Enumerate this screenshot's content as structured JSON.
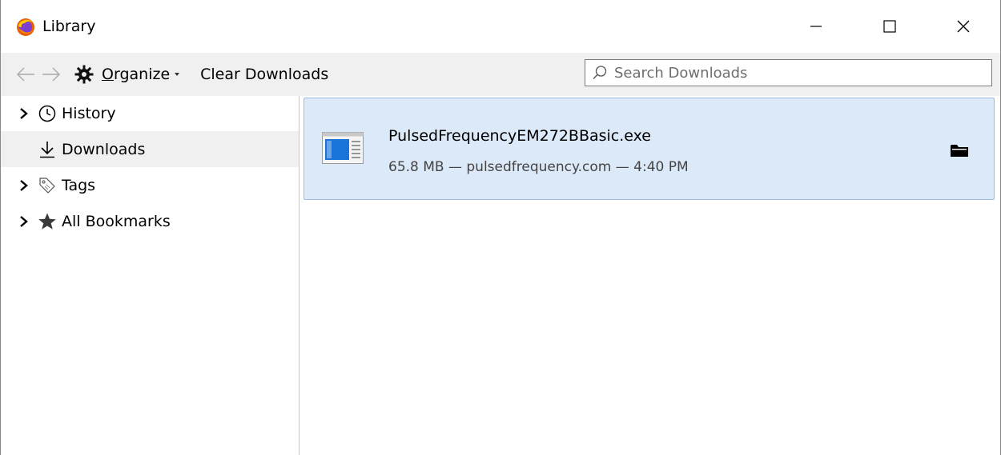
{
  "window": {
    "title": "Library",
    "controls": [
      "minimize",
      "maximize",
      "close"
    ]
  },
  "toolbar": {
    "organize_label_underlined": "O",
    "organize_label_rest": "rganize",
    "clear_downloads_label": "Clear Downloads",
    "search_placeholder": "Search Downloads",
    "search_value": ""
  },
  "sidebar": {
    "items": [
      {
        "label": "History",
        "icon": "clock-icon",
        "expandable": true,
        "selected": false
      },
      {
        "label": "Downloads",
        "icon": "download-icon",
        "expandable": false,
        "selected": true
      },
      {
        "label": "Tags",
        "icon": "tag-icon",
        "expandable": true,
        "selected": false
      },
      {
        "label": "All Bookmarks",
        "icon": "star-icon",
        "expandable": true,
        "selected": false
      }
    ]
  },
  "downloads": [
    {
      "file_name": "PulsedFrequencyEM272BBasic.exe",
      "status": "65.8 MB — pulsedfrequency.com — 4:40 PM",
      "icon": "executable-file-icon",
      "selected": true
    }
  ],
  "colors": {
    "selection_bg": "#dce9f8",
    "selection_border": "#9dbde2",
    "toolbar_bg": "#f0f0f0",
    "file_icon_blue": "#1a73d8"
  }
}
